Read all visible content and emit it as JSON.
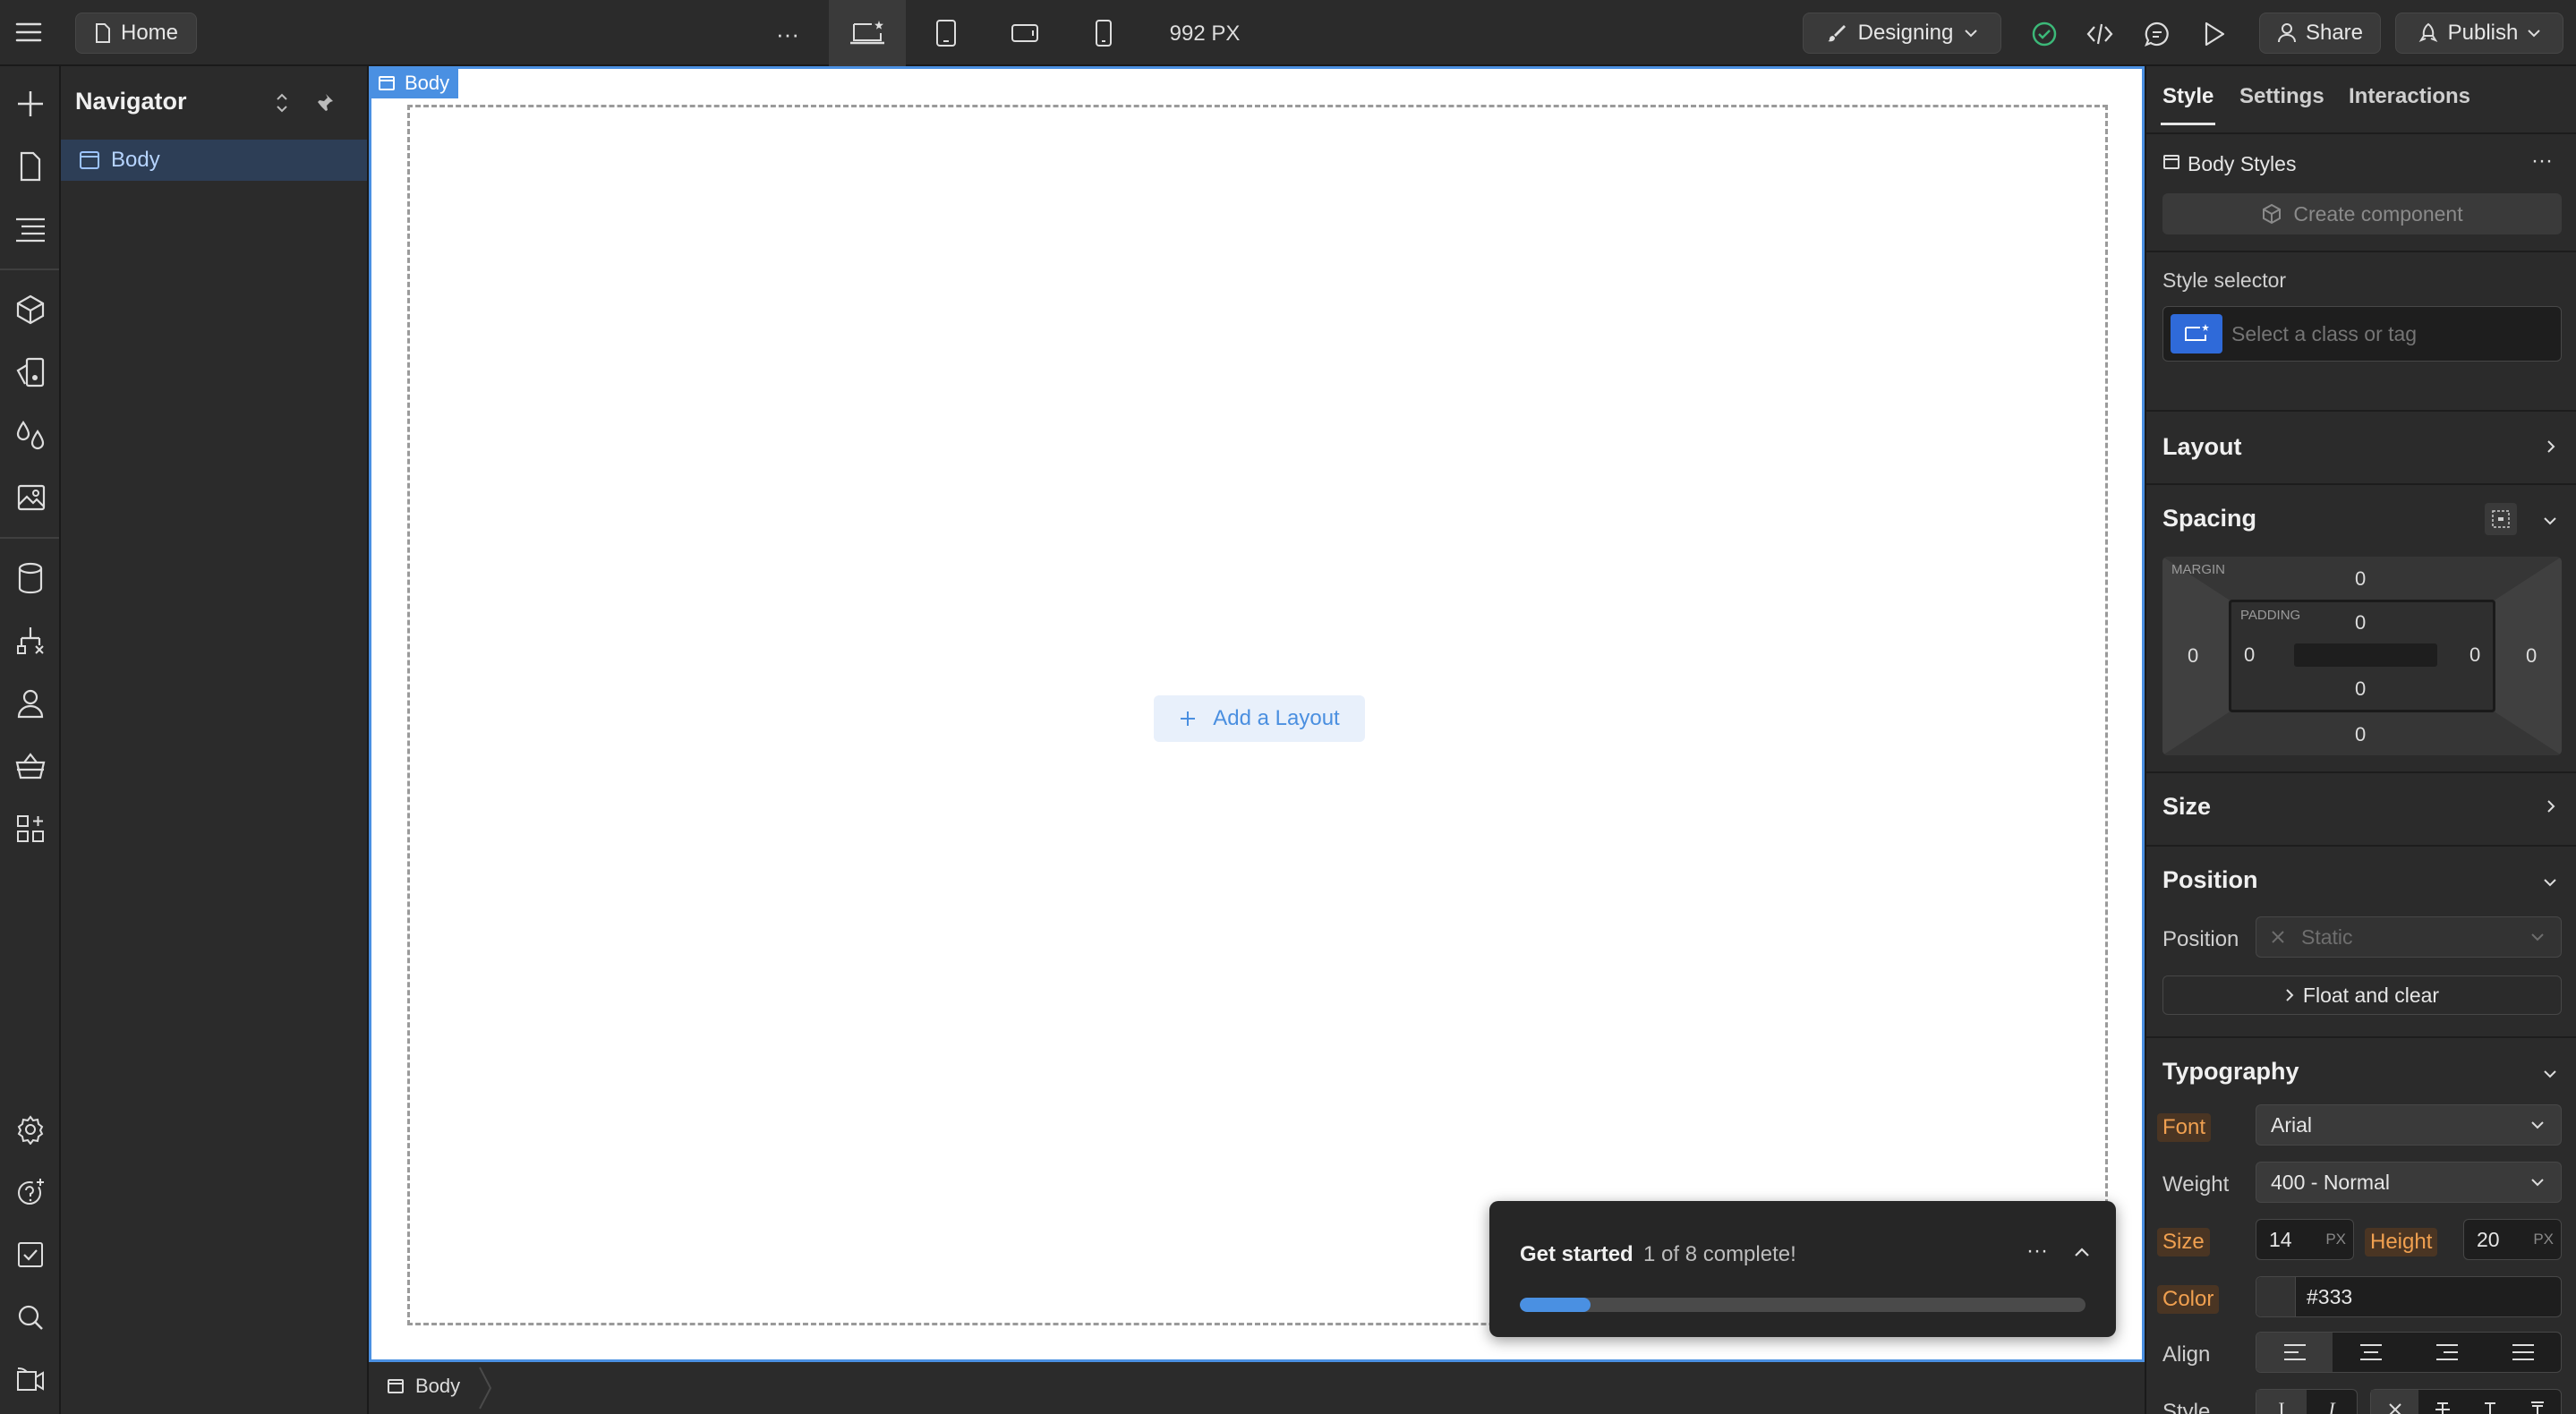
{
  "topbar": {
    "home_label": "Home",
    "more_label": "···",
    "width_readout": "992 PX",
    "mode_label": "Designing",
    "share_label": "Share",
    "publish_label": "Publish"
  },
  "navigator": {
    "title": "Navigator",
    "tree": [
      {
        "label": "Body",
        "selected": true
      }
    ]
  },
  "canvas": {
    "body_tag": "Body",
    "add_layout_label": "Add a Layout",
    "breadcrumb_label": "Body"
  },
  "get_started": {
    "title": "Get started",
    "status": "1 of 8 complete!",
    "progress": 0.125,
    "more_label": "···"
  },
  "style_panel": {
    "tabs": [
      {
        "label": "Style",
        "active": true
      },
      {
        "label": "Settings",
        "active": false
      },
      {
        "label": "Interactions",
        "active": false
      }
    ],
    "body_styles_label": "Body Styles",
    "create_component_label": "Create component",
    "style_selector_label": "Style selector",
    "selector_placeholder": "Select a class or tag",
    "sections": {
      "layout": "Layout",
      "spacing": "Spacing",
      "size": "Size",
      "position": "Position",
      "typography": "Typography"
    },
    "spacing": {
      "margin_label": "MARGIN",
      "padding_label": "PADDING",
      "margin": {
        "top": "0",
        "right": "0",
        "bottom": "0",
        "left": "0"
      },
      "padding": {
        "top": "0",
        "right": "0",
        "bottom": "0",
        "left": "0"
      }
    },
    "position": {
      "label": "Position",
      "value": "Static",
      "float_clear_label": "Float and clear"
    },
    "typography": {
      "font_label": "Font",
      "font_value": "Arial",
      "weight_label": "Weight",
      "weight_value": "400 - Normal",
      "size_label": "Size",
      "size_value": "14",
      "size_unit": "PX",
      "height_label": "Height",
      "height_value": "20",
      "height_unit": "PX",
      "color_label": "Color",
      "color_value": "#333",
      "align_label": "Align",
      "style_label": "Style"
    }
  },
  "colors": {
    "accent": "#4a90e2",
    "selected_row": "#2d3e56",
    "text_color_swatch": "#333333"
  }
}
